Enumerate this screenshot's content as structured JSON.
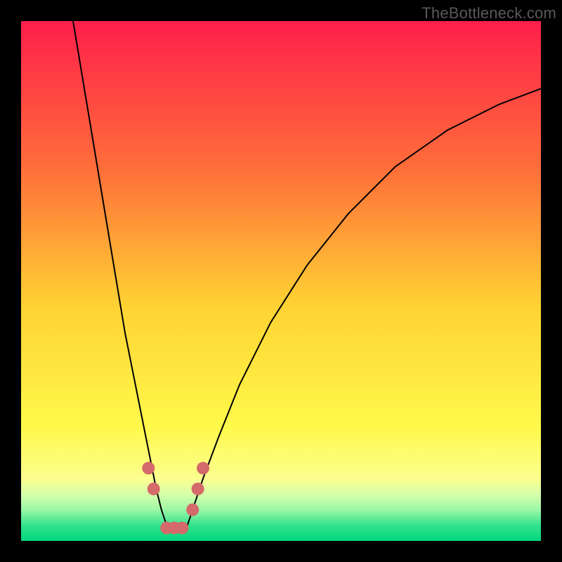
{
  "watermark": {
    "text": "TheBottleneck.com"
  },
  "chart_data": {
    "type": "line",
    "title": "",
    "xlabel": "",
    "ylabel": "",
    "xlim": [
      0,
      100
    ],
    "ylim": [
      0,
      100
    ],
    "grid": false,
    "legend": false,
    "background": {
      "type": "vertical-gradient",
      "stops": [
        {
          "offset": 0.0,
          "color": "#ff1f4b"
        },
        {
          "offset": 0.28,
          "color": "#ff6d3a"
        },
        {
          "offset": 0.55,
          "color": "#ffd333"
        },
        {
          "offset": 0.78,
          "color": "#fff94a"
        },
        {
          "offset": 0.88,
          "color": "#fcff8f"
        },
        {
          "offset": 0.91,
          "color": "#d7ffab"
        },
        {
          "offset": 0.94,
          "color": "#9cf7a6"
        },
        {
          "offset": 0.97,
          "color": "#33e38d"
        },
        {
          "offset": 1.0,
          "color": "#00d67c"
        }
      ]
    },
    "series": [
      {
        "name": "bottleneck-curve",
        "stroke": "#000000",
        "stroke_width": 2,
        "x": [
          10,
          12,
          14,
          16,
          18,
          20,
          22,
          24,
          25,
          26,
          27,
          28,
          29,
          30,
          31,
          32,
          33,
          35,
          38,
          42,
          48,
          55,
          63,
          72,
          82,
          92,
          100
        ],
        "y": [
          100,
          88,
          76,
          64,
          52,
          40,
          30,
          20,
          15,
          10,
          6,
          3,
          2,
          2,
          2,
          3,
          6,
          12,
          20,
          30,
          42,
          53,
          63,
          72,
          79,
          84,
          87
        ]
      }
    ],
    "markers": {
      "name": "highlight-points",
      "color": "#d46a6a",
      "radius": 9,
      "points": [
        {
          "x": 24.5,
          "y": 14
        },
        {
          "x": 25.5,
          "y": 10
        },
        {
          "x": 28,
          "y": 2.5
        },
        {
          "x": 29.5,
          "y": 2.5
        },
        {
          "x": 31,
          "y": 2.5
        },
        {
          "x": 33,
          "y": 6
        },
        {
          "x": 34,
          "y": 10
        },
        {
          "x": 35,
          "y": 14
        }
      ]
    }
  }
}
